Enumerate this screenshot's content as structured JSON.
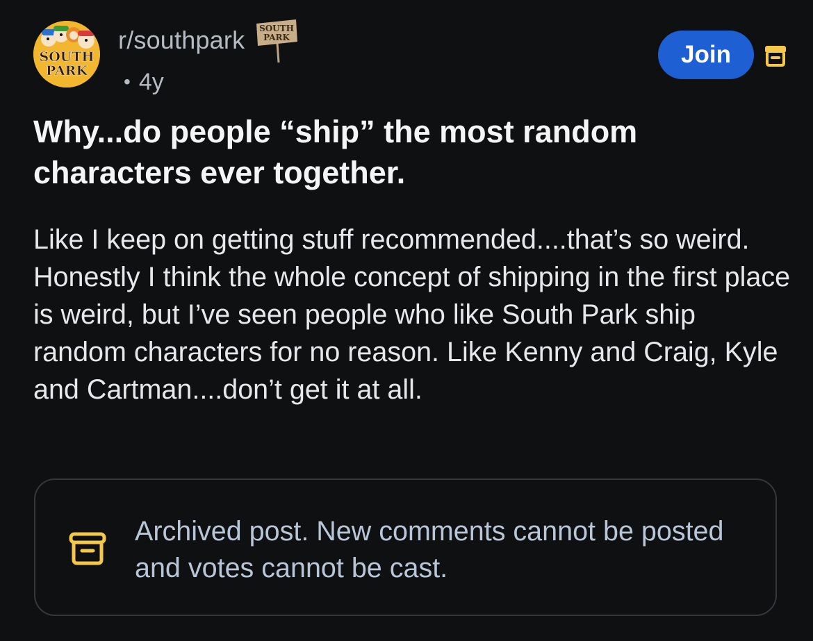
{
  "header": {
    "subreddit": "r/southpark",
    "avatar_text_line1": "SOUTH",
    "avatar_text_line2": "PARK",
    "flair_text_line1": "SOUTH",
    "flair_text_line2": "PARK",
    "separator": "•",
    "age": "4y",
    "join_label": "Join",
    "archive_icon": "archive-icon"
  },
  "post": {
    "title": "Why...do people “ship” the most random characters ever together.",
    "body": "Like I keep on getting stuff recommended....that’s so weird. Honestly I think the whole concept of shipping in the first place is weird, but I’ve seen people who like South Park ship random characters for no reason. Like Kenny and Craig, Kyle and Cartman....don’t get it at all."
  },
  "notice": {
    "icon": "archive-icon",
    "text": "Archived post. New comments cannot be posted and votes cannot be cast."
  },
  "colors": {
    "background": "#0f1012",
    "join_button": "#1f5fd4",
    "archive_accent": "#f5c84c",
    "notice_text": "#b9c6d8"
  }
}
